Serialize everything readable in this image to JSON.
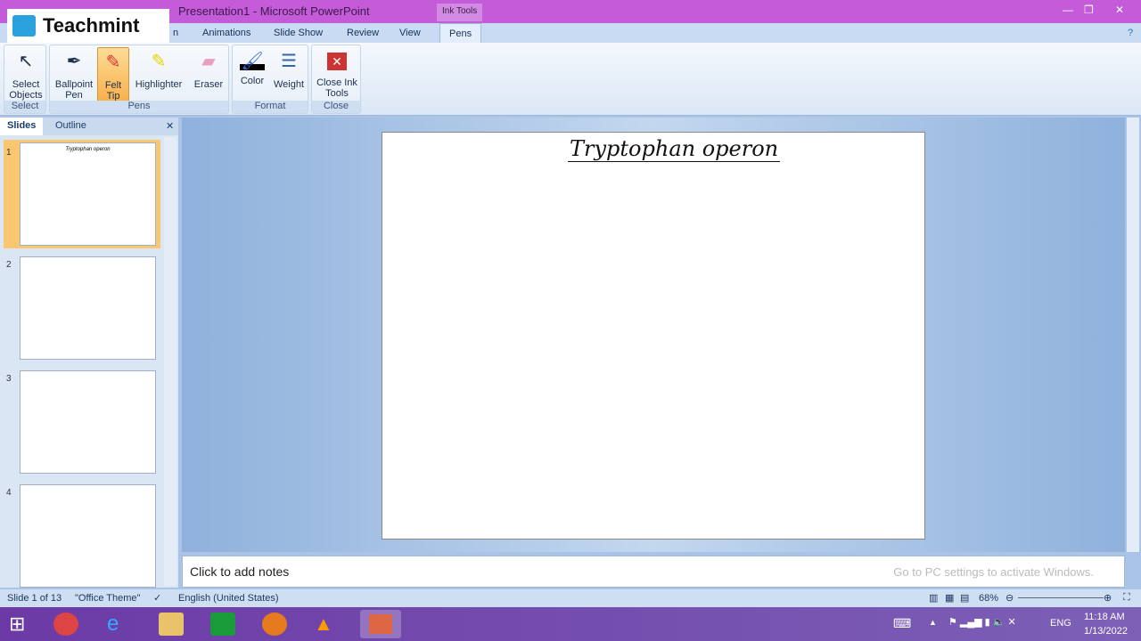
{
  "window": {
    "title": "Presentation1 - Microsoft PowerPoint",
    "context_tab": "Ink Tools"
  },
  "watermark": "Teachmint",
  "tabs": [
    "n",
    "Animations",
    "Slide Show",
    "Review",
    "View",
    "Pens"
  ],
  "ribbon": {
    "groups": {
      "select": "Select",
      "pens": "Pens",
      "format": "Format",
      "close": "Close"
    },
    "buttons": {
      "select_objects": "Select Objects",
      "ballpoint": "Ballpoint Pen",
      "felt": "Felt Tip Pen",
      "highlighter": "Highlighter",
      "eraser": "Eraser",
      "color": "Color",
      "weight": "Weight",
      "close_ink": "Close Ink Tools"
    }
  },
  "panel": {
    "tabs": [
      "Slides",
      "Outline"
    ],
    "slides": [
      "1",
      "2",
      "3",
      "4"
    ],
    "thumb1_text": "Tryptophan operon"
  },
  "slide": {
    "handwritten_title": "Tryptophan operon"
  },
  "notes": {
    "placeholder": "Click to add notes",
    "activation": "Go to PC settings to activate Windows."
  },
  "status": {
    "slide": "Slide 1 of 13",
    "theme": "\"Office Theme\"",
    "language": "English (United States)",
    "zoom": "68%"
  },
  "tray": {
    "lang": "ENG",
    "time": "11:18 AM",
    "date": "1/13/2022"
  }
}
